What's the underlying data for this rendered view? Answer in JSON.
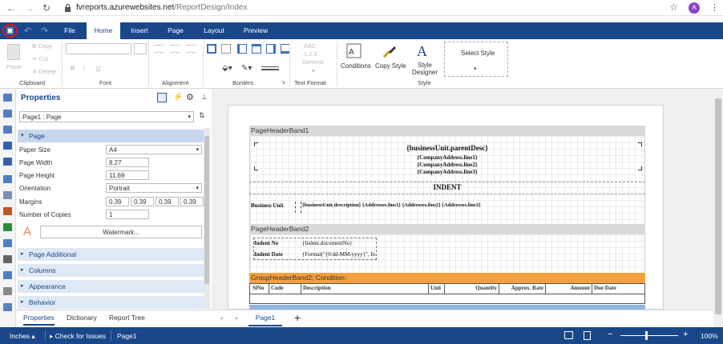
{
  "browser": {
    "url_host": "fvreports.azurewebsites.net",
    "url_path": "/ReportDesign/Index",
    "avatar": "A"
  },
  "ribbon": {
    "tabs": [
      "File",
      "Home",
      "Insert",
      "Page",
      "Layout",
      "Preview"
    ],
    "active_tab": "Home",
    "clipboard": {
      "paste": "Paste",
      "copy": "Copy",
      "cut": "Cut",
      "delete": "Delete",
      "label": "Clipboard"
    },
    "font": {
      "bold": "B",
      "italic": "I",
      "underline": "U",
      "label": "Font"
    },
    "alignment": {
      "label": "Alignment"
    },
    "borders": {
      "label": "Borders"
    },
    "text_format": {
      "abc": "ABC",
      "num": "1.2.3",
      "general": "General",
      "label": "Text Format"
    },
    "style": {
      "conditions": "Conditions",
      "copy_style": "Copy Style",
      "designer_l1": "Style",
      "designer_l2": "Designer",
      "select_style": "Select Style",
      "label": "Style"
    }
  },
  "properties": {
    "title": "Properties",
    "selector": "Page1 : Page",
    "category_page": "Page",
    "rows": {
      "paper_size": {
        "label": "Paper Size",
        "value": "A4"
      },
      "page_width": {
        "label": "Page Width",
        "value": "8.27"
      },
      "page_height": {
        "label": "Page Height",
        "value": "11.69"
      },
      "orientation": {
        "label": "Orientation",
        "value": "Portrait"
      },
      "margins": {
        "label": "Margins",
        "v1": "0.39",
        "v2": "0.39",
        "v3": "0.39",
        "v4": "0.39"
      },
      "copies": {
        "label": "Number of Copies",
        "value": "1"
      }
    },
    "watermark_icon": "A",
    "watermark": "Watermark...",
    "categories": [
      "Page Additional",
      "Columns",
      "Appearance",
      "Behavior"
    ],
    "bottom_tabs": [
      "Properties",
      "Dictionary",
      "Report Tree"
    ]
  },
  "report": {
    "band1": "PageHeaderBand1",
    "parent_desc": "{businessUnit.parentDesc}",
    "line1": "{CompanyAddress.line1}",
    "line2": "{CompanyAddress.line2}",
    "line3": "{CompanyAddress.line3}",
    "indent_title": "INDENT",
    "business_unit_label": "Business Unit",
    "business_unit_value": "{businessUnit.description} {Addresses.line1} {Addresses.line2} {Addresses.line3}",
    "band2": "PageHeaderBand2",
    "indent_no_label": "Indent No",
    "indent_no_value": "{Indent.documentNo}",
    "indent_date_label": "Indent Date",
    "indent_date_value": "{Format(\"{0:dd-MM-yyyy}\", In",
    "group_band": "GroupHeaderBand2; Condition:",
    "columns": [
      "SlNo",
      "Code",
      "Description",
      "Unit",
      "Quantity",
      "Approx. Rate",
      "Amount",
      "Due Date"
    ]
  },
  "canvas_tabs": {
    "page": "Page1",
    "add": "+"
  },
  "status": {
    "units": "Inches",
    "check": "Check for Issues",
    "page": "Page1",
    "minus": "−",
    "plus": "+",
    "zoom": "100%"
  }
}
